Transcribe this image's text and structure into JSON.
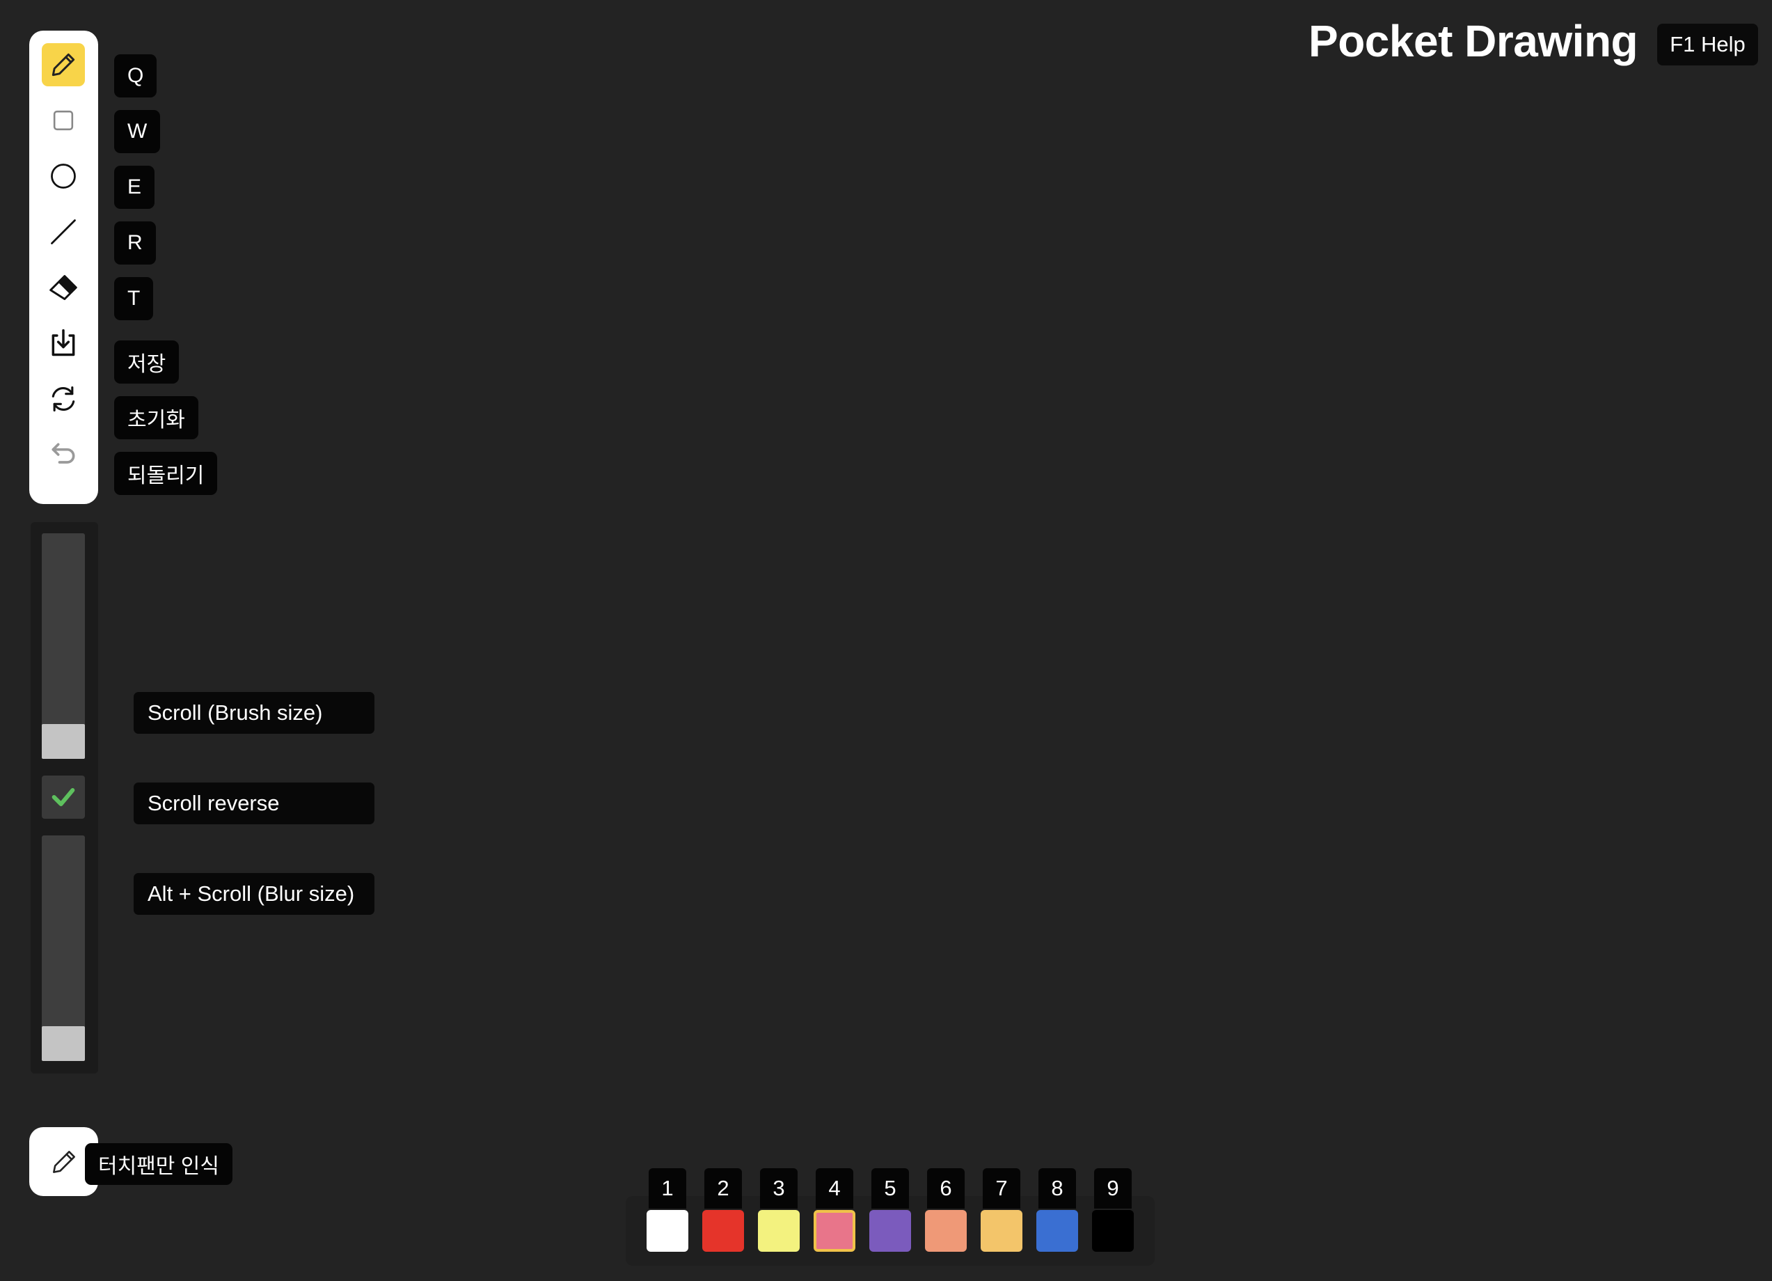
{
  "header": {
    "title": "Pocket Drawing",
    "help_label": "F1 Help"
  },
  "tools": [
    {
      "name": "pencil-icon",
      "shortcut": "Q"
    },
    {
      "name": "rectangle-icon",
      "shortcut": "W"
    },
    {
      "name": "circle-icon",
      "shortcut": "E"
    },
    {
      "name": "line-icon",
      "shortcut": "R"
    },
    {
      "name": "eraser-icon",
      "shortcut": "T"
    },
    {
      "name": "save-icon",
      "label": "저장"
    },
    {
      "name": "reset-icon",
      "label": "초기화"
    },
    {
      "name": "undo-icon",
      "label": "되돌리기"
    }
  ],
  "sliders": {
    "brush_size_hint": "Scroll (Brush size)",
    "scroll_reverse_hint": "Scroll reverse",
    "blur_size_hint": "Alt + Scroll (Blur size)",
    "scroll_reverse_checked": true
  },
  "pen_only": {
    "label": "터치팬만 인식"
  },
  "palette": {
    "numbers": [
      "1",
      "2",
      "3",
      "4",
      "5",
      "6",
      "7",
      "8",
      "9"
    ],
    "colors": [
      "#ffffff",
      "#e5342a",
      "#f3f27f",
      "#e8758a",
      "#7b5bbd",
      "#ef9977",
      "#f3c56a",
      "#3a6fd2",
      "#000000"
    ],
    "selected_index": 3
  },
  "colors": {
    "active_tool": "#f8d449",
    "check": "#5ec05e",
    "selection_border": "#f0c24a"
  }
}
